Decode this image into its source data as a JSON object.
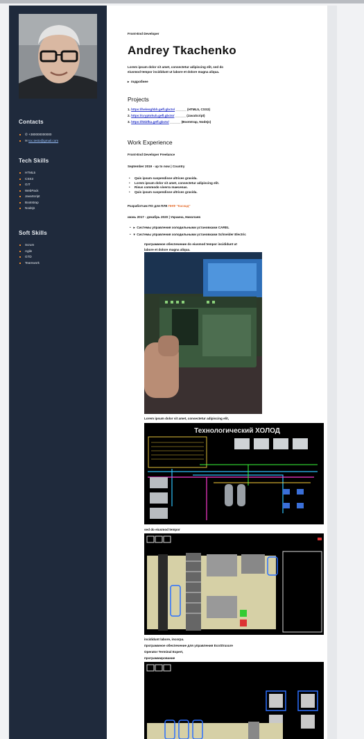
{
  "sidebar": {
    "contacts_title": "Contacts",
    "phone": "+380000000000",
    "email": "toc.testo@gmail.com",
    "tech_title": "Tech Skills",
    "tech_skills": [
      "HTML5",
      "CSS3",
      "GIT",
      "WebPack",
      "JavaScript",
      "Bootstrap",
      "Nodejs"
    ],
    "soft_title": "Soft Skills",
    "soft_skills": [
      "Scrum",
      "Agile",
      "GTD",
      "Teamwork"
    ]
  },
  "header": {
    "role": "Front-End Developer",
    "name": "Andrey Tkachenko",
    "intro_line1": "Lorem ipsum dolor sit amet, consectetur adipiscing elit, sed do",
    "intro_line2": "eiusmod tempor incididunt ut labore et dolore magna aliqua.",
    "more_link": "подробнее"
  },
  "projects": {
    "title": "Projects",
    "items": [
      {
        "num": "1.",
        "url": "https://helenghbh.gefl.gbcto/",
        "tech": "(HTML5, CSS3)"
      },
      {
        "num": "2.",
        "url": "https://cryptohub.gefl.gbcto/",
        "tech": "(JavaScript)"
      },
      {
        "num": "3.",
        "url": "https://hkbfka.gefl.gbcto/",
        "tech": "(Bootstrap, Nodejs)"
      }
    ]
  },
  "experience": {
    "title": "Work Experience",
    "job1_title": "Front-End Developer Freelance",
    "job1_dates": "September 2019 - up to now | Country",
    "job1_items": [
      "Quis ipsum suspendisse ultrices gravida.",
      "Lorem ipsum dolor sit amet, consectetur adipiscing elit.",
      "Risus commodo viverra maecenas.",
      "Quis ipsum suspendisse ultrices gravida."
    ],
    "job2_title_prefix": "Разработчик ПО для ПЛК ",
    "job2_company": "ПНФ \"Каскад\"",
    "job2_dates": "июнь 2017 - декабрь 2020 | Украина, Николаев",
    "job2_item1": "Системы управления холодильными установками CAREL",
    "job2_item2": "Системы управления холодильными установками Schneider Electric",
    "program_line1": "программное обеспечение do eiusmod tempor incididunt ut",
    "program_line2": "labore et dolore magna aliqua.",
    "caption1": "Lorem ipsum dolor sit amet, consectetur adipiscing elit,",
    "hmi_title": "Технологический ХОЛОД",
    "caption2": "sed do eiusmod tempor",
    "caption3_line1": "incididunt labore, incorpa.",
    "caption3_line2": "программное обеспечение для управления EcoStruxure",
    "caption3_line3": "Operator Terminal Expert,",
    "caption3_line4": "программирование"
  },
  "colors": {
    "sidebar_bg": "#1f2a3c",
    "accent": "#f08a2c",
    "link": "#2a37c9",
    "hmi_bg": "#000000"
  }
}
